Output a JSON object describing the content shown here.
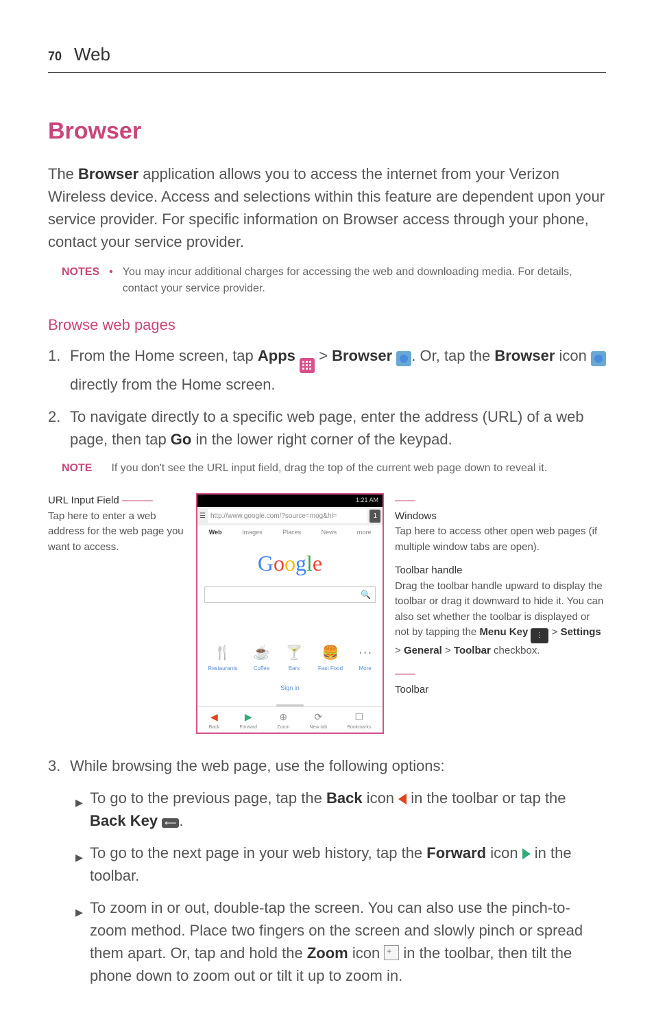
{
  "page": {
    "number": "70",
    "section": "Web"
  },
  "h1": "Browser",
  "intro": {
    "pre": "The ",
    "bold": "Browser",
    "post": " application allows you to access the internet from your Verizon Wireless device. Access and selections within this feature are dependent upon your service provider. For specific information on Browser access through your phone, contact your service provider."
  },
  "notes": {
    "label": "NOTES",
    "bullet": "•",
    "text": "You may incur additional charges for accessing the web and downloading media. For details, contact your service provider."
  },
  "h2": "Browse web pages",
  "step1": {
    "num": "1.",
    "a": "From the Home screen, tap ",
    "apps": "Apps",
    "gt1": " > ",
    "browser": "Browser",
    "mid": ". Or, tap the ",
    "browser2": "Browser",
    "b": " icon ",
    "c": " directly from the Home screen."
  },
  "step2": {
    "num": "2.",
    "a": "To navigate directly to a specific web page, enter the address (URL) of a web page, then tap ",
    "go": "Go",
    "b": " in the lower right corner of the keypad."
  },
  "note2": {
    "label": "NOTE",
    "text": "If you don't see the URL input field, drag the top of the current web page down to reveal it."
  },
  "annot": {
    "left": {
      "head": "URL Input Field",
      "body": "Tap here to enter a web address for the web page you want to access."
    },
    "right_win": {
      "head": "Windows",
      "body": "Tap here to access other open web pages (if multiple window tabs are open)."
    },
    "right_handle": {
      "head": "Toolbar handle",
      "body_a": "Drag the toolbar handle upward to display the toolbar or drag it downward to hide it. You can also set whether the toolbar is displayed or not by tapping the ",
      "menu": "Menu Key",
      "gt1": " > ",
      "settings": "Settings",
      "gt2": " > ",
      "general": "General",
      "gt3": " > ",
      "toolbar": "Toolbar",
      "body_b": " checkbox."
    },
    "right_toolbar": "Toolbar"
  },
  "phone": {
    "time": "1:21 AM",
    "url": "http://www.google.com/?source=mog&hl=",
    "win": "1",
    "tabs": [
      "Web",
      "Images",
      "Places",
      "News",
      "more"
    ],
    "search_icon": "🔍",
    "cats": [
      {
        "icon": "🍴",
        "label": "Restaurants"
      },
      {
        "icon": "☕",
        "label": "Coffee"
      },
      {
        "icon": "🍸",
        "label": "Bars"
      },
      {
        "icon": "🍔",
        "label": "Fast Food"
      },
      {
        "icon": "⋯",
        "label": "More"
      }
    ],
    "signin": "Sign in",
    "toolbar": [
      {
        "icon": "◀",
        "label": "Back",
        "cls": "tb-back"
      },
      {
        "icon": "▶",
        "label": "Forward",
        "cls": "tb-fwd"
      },
      {
        "icon": "⊕",
        "label": "Zoom"
      },
      {
        "icon": "⟳",
        "label": "New tab"
      },
      {
        "icon": "☐",
        "label": "Bookmarks"
      }
    ]
  },
  "step3": {
    "num": "3.",
    "text": "While browsing the web page, use the following options:"
  },
  "bullets": {
    "b1": {
      "a": "To go to the previous page, tap the ",
      "back": "Back",
      "b": " icon ",
      "c": " in the toolbar or tap the ",
      "backkey": "Back Key",
      "d": "."
    },
    "b2": {
      "a": "To go to the next page in your web history, tap the ",
      "fwd": "Forward",
      "b": " icon ",
      "c": " in the toolbar."
    },
    "b3": {
      "a": "To zoom in or out, double-tap the screen. You can also use the pinch-to-zoom method. Place two fingers on the screen and slowly pinch or spread them apart. Or, tap and hold the ",
      "zoom": "Zoom",
      "b": " icon ",
      "c": " in the toolbar, then tilt the phone down to zoom out or tilt it up to zoom in."
    }
  }
}
